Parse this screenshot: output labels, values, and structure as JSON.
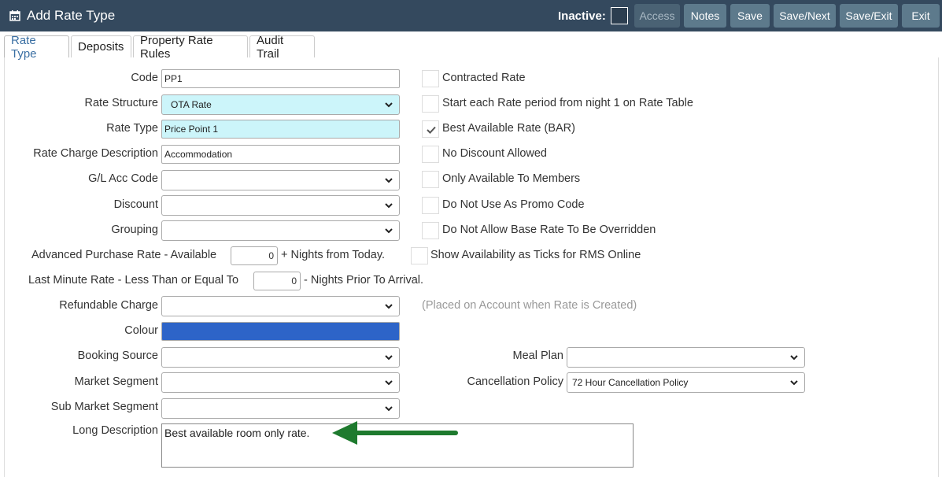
{
  "header": {
    "title": "Add Rate Type",
    "inactive_label": "Inactive:",
    "buttons": {
      "access": "Access",
      "notes": "Notes",
      "save": "Save",
      "save_next": "Save/Next",
      "save_exit": "Save/Exit",
      "exit": "Exit"
    }
  },
  "tabs": [
    "Rate Type",
    "Deposits",
    "Property Rate Rules",
    "Audit Trail"
  ],
  "form": {
    "code": {
      "label": "Code",
      "value": "PP1"
    },
    "rate_structure": {
      "label": "Rate Structure",
      "value": "OTA Rate"
    },
    "rate_type": {
      "label": "Rate Type",
      "value": "Price Point 1"
    },
    "rate_charge_description": {
      "label": "Rate Charge Description",
      "value": "Accommodation"
    },
    "gl_acc_code": {
      "label": "G/L Acc Code",
      "value": ""
    },
    "discount": {
      "label": "Discount",
      "value": ""
    },
    "grouping": {
      "label": "Grouping",
      "value": ""
    },
    "advanced_purchase": {
      "label": "Advanced Purchase Rate - Available",
      "value": "0",
      "suffix": "+ Nights from Today."
    },
    "last_minute": {
      "label": "Last Minute Rate - Less Than or Equal To",
      "value": "0",
      "suffix": "- Nights Prior To Arrival."
    },
    "refundable_charge": {
      "label": "Refundable Charge",
      "value": "",
      "hint": "(Placed on Account when Rate is Created)"
    },
    "colour": {
      "label": "Colour",
      "value": "#2d64c8"
    },
    "booking_source": {
      "label": "Booking Source",
      "value": ""
    },
    "market_segment": {
      "label": "Market Segment",
      "value": ""
    },
    "sub_market_segment": {
      "label": "Sub Market Segment",
      "value": ""
    },
    "long_description": {
      "label": "Long Description",
      "value": "Best available room only rate."
    },
    "meal_plan": {
      "label": "Meal Plan",
      "value": ""
    },
    "cancellation_policy": {
      "label": "Cancellation Policy",
      "value": "72 Hour Cancellation Policy"
    }
  },
  "checkboxes": [
    {
      "label": "Contracted Rate",
      "checked": false
    },
    {
      "label": "Start each Rate period from night 1 on Rate Table",
      "checked": false
    },
    {
      "label": "Best Available Rate (BAR)",
      "checked": true
    },
    {
      "label": "No Discount Allowed",
      "checked": false
    },
    {
      "label": "Only Available To Members",
      "checked": false
    },
    {
      "label": "Do Not Use As Promo Code",
      "checked": false
    },
    {
      "label": "Do Not Allow Base Rate To Be Overridden",
      "checked": false
    },
    {
      "label": "Show Availability as Ticks for RMS Online",
      "checked": false
    }
  ],
  "colors": {
    "header_bg": "#34495e",
    "button_bg": "#5d7a8c",
    "cyan_field": "#ccf5fa",
    "colour_swatch": "#2d64c8",
    "arrow": "#1e7a2e",
    "active_tab": "#3a6fa3"
  },
  "icons": {
    "title": "calendar-icon",
    "select": "chevron-down-icon",
    "check": "checkmark-icon",
    "annotation": "arrow-left-icon"
  }
}
